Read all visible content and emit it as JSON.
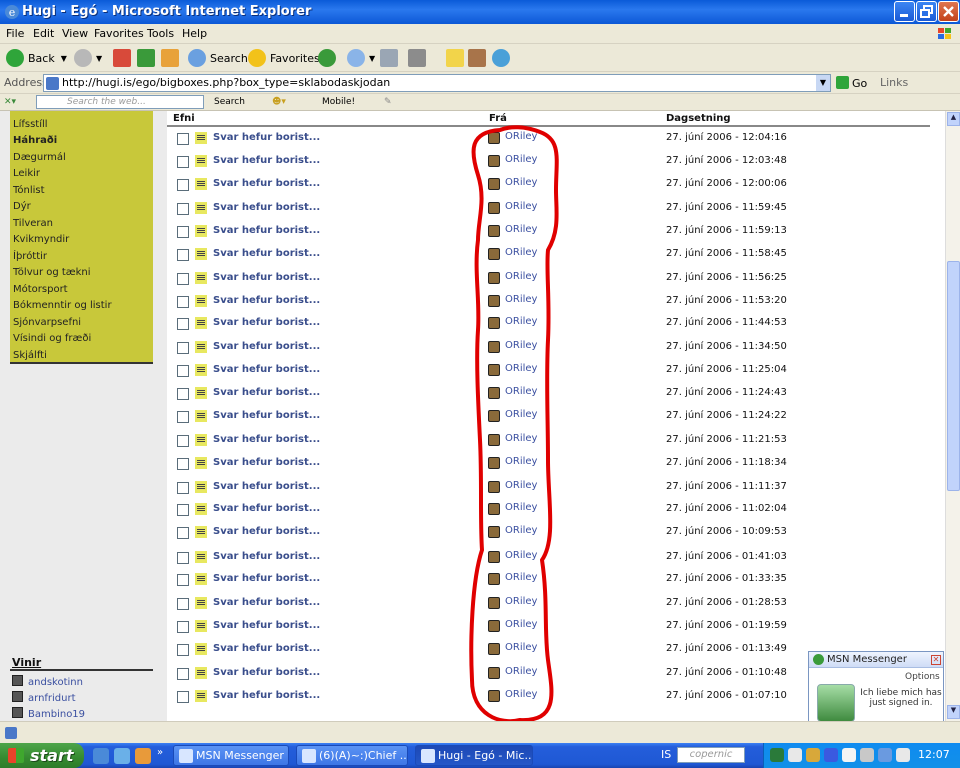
{
  "window": {
    "title": "Hugi - Egó - Microsoft Internet Explorer"
  },
  "menu": [
    "File",
    "Edit",
    "View",
    "Favorites",
    "Tools",
    "Help"
  ],
  "toolbar": {
    "back": "Back",
    "search": "Search",
    "favorites": "Favorites"
  },
  "address": {
    "label": "Address",
    "url": "http://hugi.is/ego/bigboxes.php?box_type=sklabodaskjodan",
    "go": "Go",
    "links": "Links"
  },
  "searchbar": {
    "placeholder": "Search the web...",
    "search": "Search",
    "mobile": "Mobile!"
  },
  "categories": [
    {
      "label": "Lífsstíll",
      "bold": false
    },
    {
      "label": "Háhraði",
      "bold": true
    },
    {
      "label": "Dægurmál",
      "bold": false
    },
    {
      "label": "Leikir",
      "bold": false
    },
    {
      "label": "Tónlist",
      "bold": false
    },
    {
      "label": "Dýr",
      "bold": false
    },
    {
      "label": "Tilveran",
      "bold": false
    },
    {
      "label": "Kvikmyndir",
      "bold": false
    },
    {
      "label": "Íþróttir",
      "bold": false
    },
    {
      "label": "Tölvur og tækni",
      "bold": false
    },
    {
      "label": "Mótorsport",
      "bold": false
    },
    {
      "label": "Bókmenntir og listir",
      "bold": false
    },
    {
      "label": "Sjónvarpsefni",
      "bold": false
    },
    {
      "label": "Vísindi og fræði",
      "bold": false
    },
    {
      "label": "Skjálfti",
      "bold": false
    }
  ],
  "friends": {
    "title": "Vinir",
    "items": [
      "andskotinn",
      "arnfridurt",
      "Bambino19"
    ]
  },
  "table": {
    "headers": {
      "subject": "Efni",
      "from": "Frá",
      "date": "Dagsetning"
    },
    "rows": [
      {
        "subject": "Svar hefur borist...",
        "from": "ORiley",
        "date": "27. júní 2006 - 12:04:16"
      },
      {
        "subject": "Svar hefur borist...",
        "from": "ORiley",
        "date": "27. júní 2006 - 12:03:48"
      },
      {
        "subject": "Svar hefur borist...",
        "from": "ORiley",
        "date": "27. júní 2006 - 12:00:06"
      },
      {
        "subject": "Svar hefur borist...",
        "from": "ORiley",
        "date": "27. júní 2006 - 11:59:45"
      },
      {
        "subject": "Svar hefur borist...",
        "from": "ORiley",
        "date": "27. júní 2006 - 11:59:13"
      },
      {
        "subject": "Svar hefur borist...",
        "from": "ORiley",
        "date": "27. júní 2006 - 11:58:45"
      },
      {
        "subject": "Svar hefur borist...",
        "from": "ORiley",
        "date": "27. júní 2006 - 11:56:25"
      },
      {
        "subject": "Svar hefur borist...",
        "from": "ORiley",
        "date": "27. júní 2006 - 11:53:20"
      },
      {
        "subject": "Svar hefur borist...",
        "from": "ORiley",
        "date": "27. júní 2006 - 11:44:53"
      },
      {
        "subject": "Svar hefur borist...",
        "from": "ORiley",
        "date": "27. júní 2006 - 11:34:50"
      },
      {
        "subject": "Svar hefur borist...",
        "from": "ORiley",
        "date": "27. júní 2006 - 11:25:04"
      },
      {
        "subject": "Svar hefur borist...",
        "from": "ORiley",
        "date": "27. júní 2006 - 11:24:43"
      },
      {
        "subject": "Svar hefur borist...",
        "from": "ORiley",
        "date": "27. júní 2006 - 11:24:22"
      },
      {
        "subject": "Svar hefur borist...",
        "from": "ORiley",
        "date": "27. júní 2006 - 11:21:53"
      },
      {
        "subject": "Svar hefur borist...",
        "from": "ORiley",
        "date": "27. júní 2006 - 11:18:34"
      },
      {
        "subject": "Svar hefur borist...",
        "from": "ORiley",
        "date": "27. júní 2006 - 11:11:37"
      },
      {
        "subject": "Svar hefur borist...",
        "from": "ORiley",
        "date": "27. júní 2006 - 11:02:04"
      },
      {
        "subject": "Svar hefur borist...",
        "from": "ORiley",
        "date": "27. júní 2006 - 10:09:53"
      },
      {
        "subject": "Svar hefur borist...",
        "from": "ORiley",
        "date": "27. júní 2006 - 01:41:03"
      },
      {
        "subject": "Svar hefur borist...",
        "from": "ORiley",
        "date": "27. júní 2006 - 01:33:35"
      },
      {
        "subject": "Svar hefur borist...",
        "from": "ORiley",
        "date": "27. júní 2006 - 01:28:53"
      },
      {
        "subject": "Svar hefur borist...",
        "from": "ORiley",
        "date": "27. júní 2006 - 01:19:59"
      },
      {
        "subject": "Svar hefur borist...",
        "from": "ORiley",
        "date": "27. júní 2006 - 01:13:49"
      },
      {
        "subject": "Svar hefur borist...",
        "from": "ORiley",
        "date": "27. júní 2006 - 01:10:48"
      },
      {
        "subject": "Svar hefur borist...",
        "from": "ORiley",
        "date": "27. júní 2006 - 01:07:10"
      }
    ]
  },
  "msn": {
    "title": "MSN Messenger",
    "options": "Options",
    "message": "Ich liebe mich has just signed in.",
    "logo": "msn"
  },
  "taskbar": {
    "start": "start",
    "tasks": [
      "MSN Messenger",
      "(6)(A)~:)Chief ...",
      "Hugi - Egó - Mic..."
    ],
    "lang": "IS",
    "copernic": "copernic",
    "clock": "12:07"
  },
  "colors": {
    "annotation": "#e00000",
    "category_bg": "#c8c83a",
    "link": "#3a4e8c"
  }
}
